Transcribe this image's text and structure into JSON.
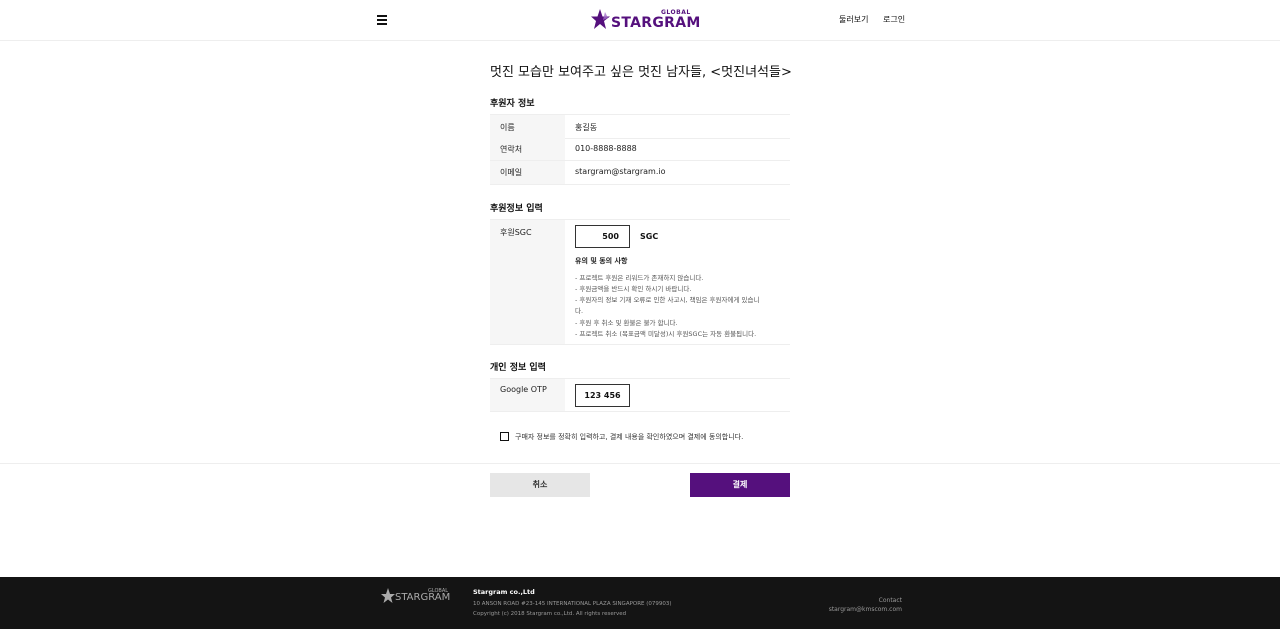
{
  "header": {
    "logo_super": "GLOBAL",
    "logo_text": "STARGRAM",
    "nav": [
      "둘러보기",
      "로그인"
    ]
  },
  "page": {
    "title": "멋진 모습만 보여주고 싶은 멋진 남자들, <멋진녀석들>"
  },
  "sponsor_info": {
    "title": "후원자 정보",
    "rows": [
      {
        "label": "이름",
        "value": "홍길동"
      },
      {
        "label": "연락처",
        "value": "010-8888-8888"
      },
      {
        "label": "이메일",
        "value": "stargram@stargram.io"
      }
    ]
  },
  "sponsor_input": {
    "title": "후원정보 입력",
    "label": "후원SGC",
    "amount": "500",
    "unit": "SGC",
    "notice_title": "유의 및 동의 사항",
    "notices": [
      "- 프로젝트 후원은 리워드가 존재하지 않습니다.",
      "- 후원금액을 반드시 확인 하시기 바랍니다.",
      "- 후원자의 정보 기재 오류로 인한 사고시, 책임은 후원자에게 있습니",
      "다.",
      "- 후원 후 취소 및 환불은 불가 합니다.",
      "- 프로젝트 취소 (목표금액 미달성)시 후원SGC는 자동 환불됩니다."
    ]
  },
  "personal_info": {
    "title": "개인 정보 입력",
    "label": "Google OTP",
    "otp_value": "123 456"
  },
  "agreement": {
    "text": "구매자 정보를 정확히 입력하고, 결제 내용을 확인하였으며 결제에 동의합니다.",
    "checked": false
  },
  "buttons": {
    "cancel": "취소",
    "pay": "결제"
  },
  "footer": {
    "logo_super": "GLOBAL",
    "logo_text": "STARGRAM",
    "company": "Stargram co.,Ltd",
    "address": "10 ANSON ROAD #23-145 INTERNATIONAL PLAZA SINGAPORE (079903)",
    "copyright": "Copyright (c) 2018 Stargram co.,Ltd. All rights reserved",
    "contact_label": "Contact",
    "contact_email": "stargram@kmscom.com"
  },
  "colors": {
    "brand": "#55107d",
    "footer_bg": "#141414"
  }
}
